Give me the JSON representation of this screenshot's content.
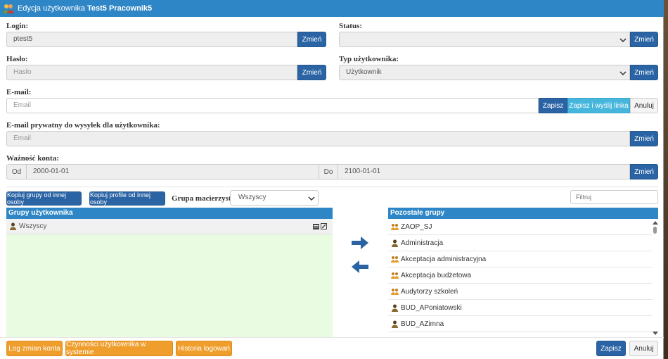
{
  "title": {
    "prefix": "Edycja użytkownika",
    "name": "Test5 Pracownik5"
  },
  "login": {
    "label": "Login:",
    "value": "ptest5",
    "button": "Zmień"
  },
  "status": {
    "label": "Status:",
    "value": "",
    "button": "Zmień"
  },
  "password": {
    "label": "Hasło:",
    "placeholder": "Hasło",
    "button": "Zmień"
  },
  "user_type": {
    "label": "Typ użytkownika:",
    "value": "Użytkownik",
    "button": "Zmień"
  },
  "email": {
    "label": "E-mail:",
    "placeholder": "Email",
    "save": "Zapisz",
    "save_send": "Zapisz i wyślij linka",
    "cancel": "Anuluj"
  },
  "private_email": {
    "label": "E-mail prywatny do wysyłek dla użytkownika:",
    "placeholder": "Email",
    "button": "Zmień"
  },
  "validity": {
    "label": "Ważność konta:",
    "from_label": "Od",
    "from": "2000-01-01",
    "to_label": "Do",
    "to": "2100-01-01",
    "button": "Zmień"
  },
  "toolbar": {
    "copy_groups": "Kopiuj grupy od innej osoby",
    "copy_profiles": "Kopiuj profile od innej osoby",
    "parent_group_label": "Grupa macierzysta:",
    "parent_group_value": "Wszyscy",
    "filter_placeholder": "Filtruj"
  },
  "user_groups": {
    "header": "Grupy użytkownika",
    "items": [
      "Wszyscy"
    ]
  },
  "other_groups": {
    "header": "Pozostałe grupy",
    "items": [
      {
        "label": "ZAOP_SJ",
        "icon": "group-icon"
      },
      {
        "label": "Administracja",
        "icon": "user-icon"
      },
      {
        "label": "Akceptacja administracyjna",
        "icon": "group-icon"
      },
      {
        "label": "Akceptacja budżetowa",
        "icon": "group-icon"
      },
      {
        "label": "Audytorzy szkoleń",
        "icon": "group-icon"
      },
      {
        "label": "BUD_APoniatowski",
        "icon": "user-icon"
      },
      {
        "label": "BUD_AZimna",
        "icon": "user-icon"
      }
    ]
  },
  "footer": {
    "log": "Log zmian konta",
    "activities": "Czynności użytkownika w systemie",
    "history": "Historia logowań",
    "save": "Zapisz",
    "cancel": "Anuluj"
  },
  "colors": {
    "header_blue": "#2e86c6",
    "button_blue": "#2a64a5",
    "button_cyan": "#47b6dc",
    "button_orange": "#ef9d2b",
    "selected_panel": "#e9fbe1"
  }
}
